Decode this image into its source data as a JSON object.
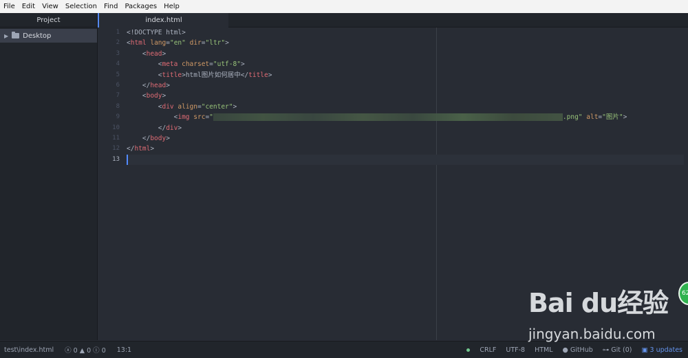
{
  "menu": [
    "File",
    "Edit",
    "View",
    "Selection",
    "Find",
    "Packages",
    "Help"
  ],
  "sidebar": {
    "header": "Project",
    "items": [
      {
        "label": "Desktop"
      }
    ]
  },
  "tabs": [
    {
      "label": "index.html"
    }
  ],
  "editor": {
    "line_numbers": [
      "1",
      "2",
      "3",
      "4",
      "5",
      "6",
      "7",
      "8",
      "9",
      "10",
      "11",
      "12",
      "13"
    ],
    "lines": [
      {
        "segments": [
          {
            "t": "punc",
            "v": "<!DOCTYPE html>"
          }
        ]
      },
      {
        "segments": [
          {
            "t": "punc",
            "v": "<"
          },
          {
            "t": "tag",
            "v": "html"
          },
          {
            "t": "punc",
            "v": " "
          },
          {
            "t": "attr",
            "v": "lang"
          },
          {
            "t": "punc",
            "v": "="
          },
          {
            "t": "str",
            "v": "\"en\""
          },
          {
            "t": "punc",
            "v": " "
          },
          {
            "t": "attr",
            "v": "dir"
          },
          {
            "t": "punc",
            "v": "="
          },
          {
            "t": "str",
            "v": "\"ltr\""
          },
          {
            "t": "punc",
            "v": ">"
          }
        ]
      },
      {
        "segments": [
          {
            "t": "punc",
            "v": "    <"
          },
          {
            "t": "tag",
            "v": "head"
          },
          {
            "t": "punc",
            "v": ">"
          }
        ]
      },
      {
        "segments": [
          {
            "t": "punc",
            "v": "        <"
          },
          {
            "t": "tag",
            "v": "meta"
          },
          {
            "t": "punc",
            "v": " "
          },
          {
            "t": "attr",
            "v": "charset"
          },
          {
            "t": "punc",
            "v": "="
          },
          {
            "t": "str",
            "v": "\"utf-8\""
          },
          {
            "t": "punc",
            "v": ">"
          }
        ]
      },
      {
        "segments": [
          {
            "t": "punc",
            "v": "        <"
          },
          {
            "t": "tag",
            "v": "title"
          },
          {
            "t": "punc",
            "v": ">html图片如何居中</"
          },
          {
            "t": "tag",
            "v": "title"
          },
          {
            "t": "punc",
            "v": ">"
          }
        ]
      },
      {
        "segments": [
          {
            "t": "punc",
            "v": "    </"
          },
          {
            "t": "tag",
            "v": "head"
          },
          {
            "t": "punc",
            "v": ">"
          }
        ]
      },
      {
        "segments": [
          {
            "t": "punc",
            "v": "    <"
          },
          {
            "t": "tag",
            "v": "body"
          },
          {
            "t": "punc",
            "v": ">"
          }
        ]
      },
      {
        "segments": [
          {
            "t": "punc",
            "v": "        <"
          },
          {
            "t": "tag",
            "v": "div"
          },
          {
            "t": "punc",
            "v": " "
          },
          {
            "t": "attr",
            "v": "align"
          },
          {
            "t": "punc",
            "v": "="
          },
          {
            "t": "str",
            "v": "\"center\""
          },
          {
            "t": "punc",
            "v": ">"
          }
        ]
      },
      {
        "segments": [
          {
            "t": "punc",
            "v": "            <"
          },
          {
            "t": "tag",
            "v": "img"
          },
          {
            "t": "punc",
            "v": " "
          },
          {
            "t": "attr",
            "v": "src"
          },
          {
            "t": "punc",
            "v": "="
          },
          {
            "t": "str",
            "v": "\""
          },
          {
            "t": "blur",
            "v": ""
          },
          {
            "t": "str",
            "v": ".png\""
          },
          {
            "t": "punc",
            "v": " "
          },
          {
            "t": "attr",
            "v": "alt"
          },
          {
            "t": "punc",
            "v": "="
          },
          {
            "t": "str",
            "v": "\"图片\""
          },
          {
            "t": "punc",
            "v": ">"
          }
        ]
      },
      {
        "segments": [
          {
            "t": "punc",
            "v": "        </"
          },
          {
            "t": "tag",
            "v": "div"
          },
          {
            "t": "punc",
            "v": ">"
          }
        ]
      },
      {
        "segments": [
          {
            "t": "punc",
            "v": "    </"
          },
          {
            "t": "tag",
            "v": "body"
          },
          {
            "t": "punc",
            "v": ">"
          }
        ]
      },
      {
        "segments": [
          {
            "t": "punc",
            "v": "</"
          },
          {
            "t": "tag",
            "v": "html"
          },
          {
            "t": "punc",
            "v": ">"
          }
        ]
      },
      {
        "segments": []
      }
    ],
    "current_line": 13
  },
  "status": {
    "file": "test\\index.html",
    "errors": "0",
    "warnings": "0",
    "infos": "0",
    "cursor": "13:1",
    "line_ending": "CRLF",
    "encoding": "UTF-8",
    "grammar": "HTML",
    "github": "GitHub",
    "git": "Git (0)",
    "updates": "3 updates"
  },
  "overlay": {
    "badge": "62",
    "watermark_logo": "Bai du经验",
    "watermark_url": "jingyan.baidu.com"
  },
  "colors": {
    "tag": "#e06c75",
    "attr": "#d19a66",
    "string": "#98c379",
    "accent": "#568af2"
  }
}
